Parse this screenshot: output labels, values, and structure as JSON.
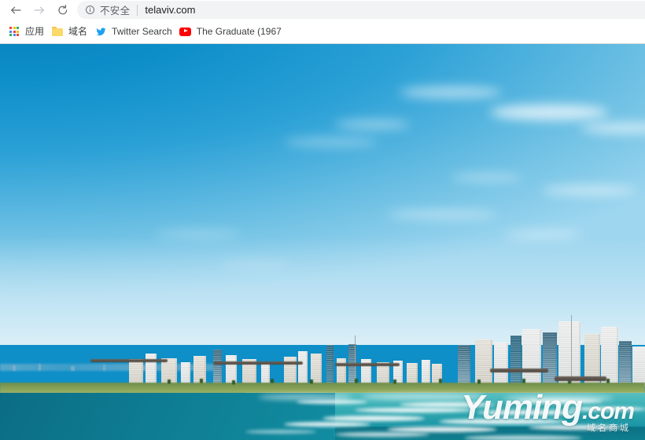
{
  "browser": {
    "toolbar": {
      "back_title": "Back",
      "forward_title": "Forward",
      "reload_title": "Reload",
      "security_label": "不安全",
      "url": "telaviv.com",
      "security_icon": "info-circle-icon"
    },
    "bookmarks": [
      {
        "label": "应用",
        "icon": "google-apps-grid-icon"
      },
      {
        "label": "域名",
        "icon": "folder-icon"
      },
      {
        "label": "Twitter Search",
        "icon": "twitter-bird-icon"
      },
      {
        "label": "The Graduate (1967",
        "icon": "youtube-icon"
      }
    ]
  },
  "page": {
    "title": "telaviv.com",
    "photo_alt": "Tel Aviv skyline and Mediterranean beach",
    "watermark": {
      "brand": "Yuming",
      "tld": ".com",
      "subtitle": "域名商城"
    }
  },
  "colors": {
    "sky_top": "#0680bd",
    "sky_bottom": "#9ed6ef",
    "sea_deep": "#0b6d85",
    "sea_shallow": "#3cb3b8",
    "sand": "#e9d9b4",
    "omnibox_bg": "#f1f3f4",
    "notsecure_text": "#5f6368",
    "url_text": "#202124",
    "youtube_red": "#ff0000",
    "twitter_blue": "#1da1f2",
    "folder_yellow": "#fbd96b"
  }
}
